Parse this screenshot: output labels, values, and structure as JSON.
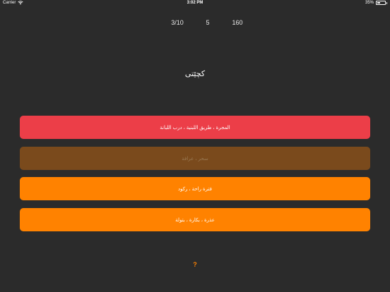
{
  "status_bar": {
    "carrier": "Carrier",
    "time": "3:02 PM",
    "battery_text": "35%",
    "battery_level": 0.35
  },
  "stats": {
    "progress": "3/10",
    "middle": "5",
    "score": "160"
  },
  "question": {
    "text": "كچێتی"
  },
  "answers": [
    {
      "label": "المجرة ، طريق اللبنية ، درب اللبانة",
      "color": "#ec3e48"
    },
    {
      "label": "سحر ، عرافة",
      "color": "#7a4a1c"
    },
    {
      "label": "فترة راحة ، ركود",
      "color": "#ff8200"
    },
    {
      "label": "عذرة ، بكارة ، بتولة",
      "color": "#ff8200"
    }
  ],
  "hint": {
    "label": "?",
    "color": "#ff8200"
  }
}
